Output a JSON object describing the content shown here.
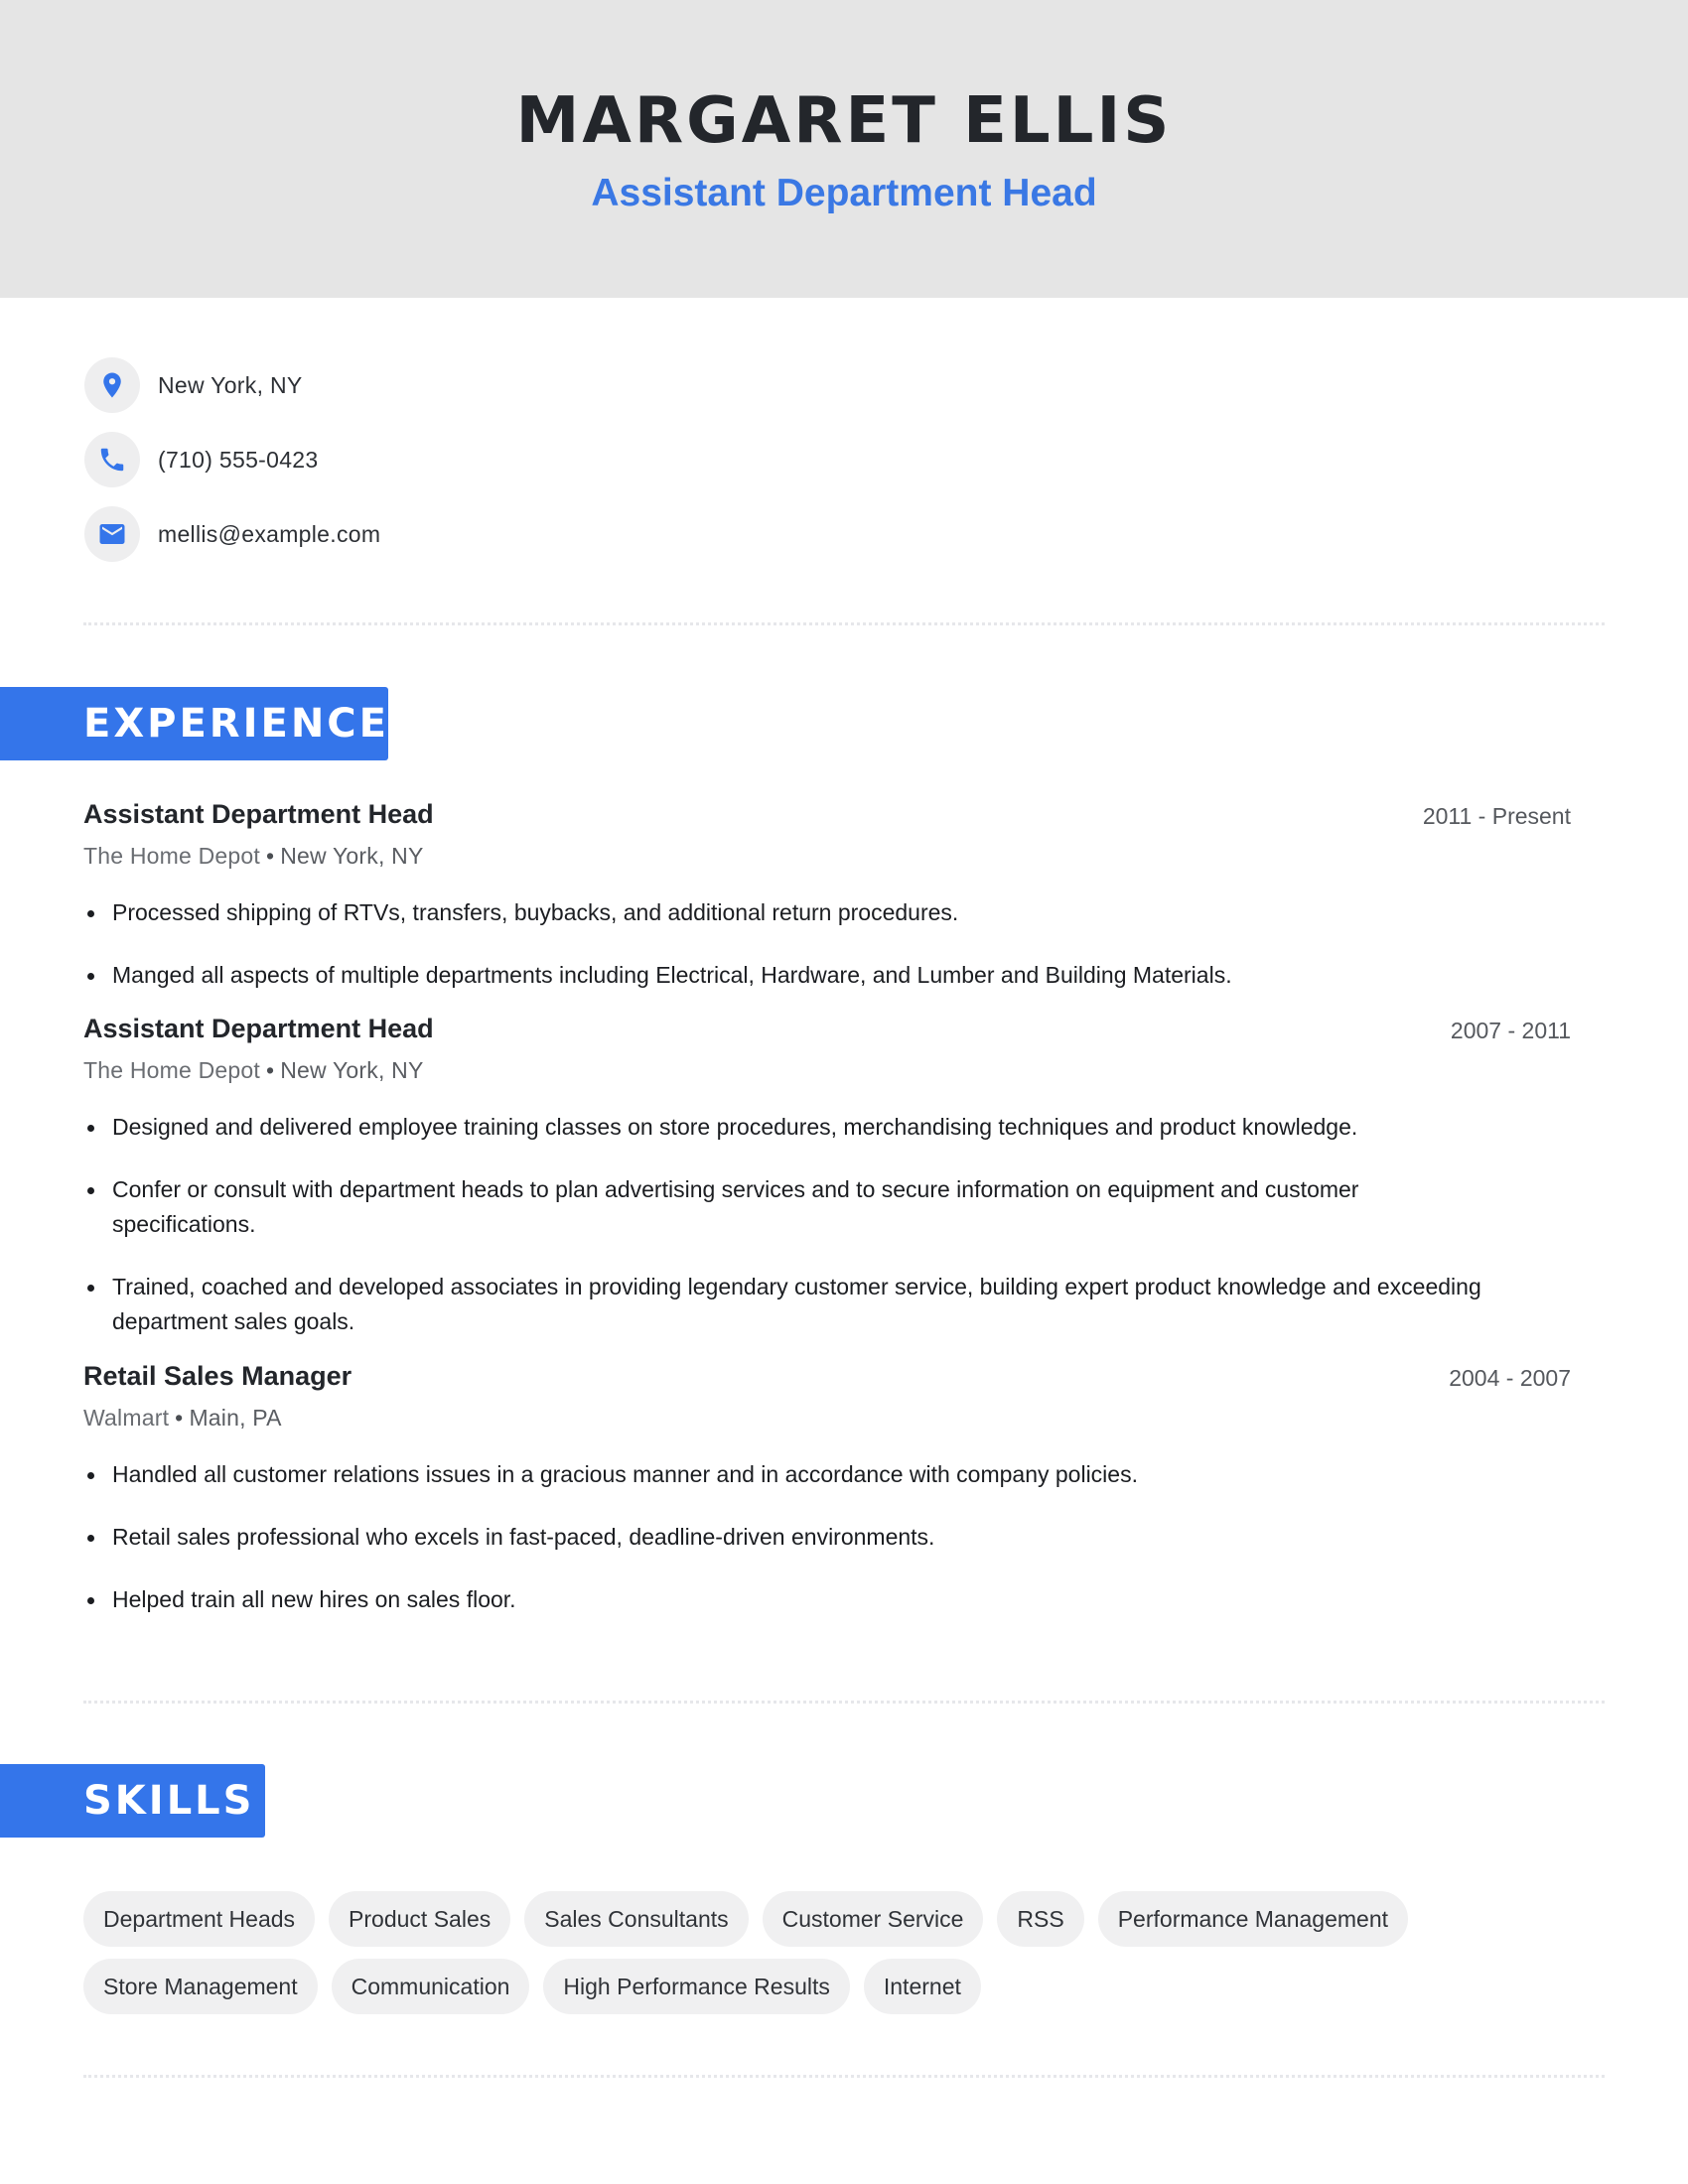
{
  "header": {
    "name": "MARGARET ELLIS",
    "headline": "Assistant Department Head"
  },
  "contact": {
    "items": [
      {
        "icon": "location-pin-icon",
        "value": "New York, NY"
      },
      {
        "icon": "phone-icon",
        "value": "(710) 555-0423"
      },
      {
        "icon": "email-icon",
        "value": "mellis@example.com"
      }
    ]
  },
  "sections": {
    "experience_title": "EXPERIENCE",
    "skills_title": "SKILLS"
  },
  "experience": [
    {
      "title": "Assistant Department Head",
      "dates": "2011 - Present",
      "company": "The Home Depot",
      "location": "New York, NY",
      "bullets": [
        "Processed shipping of RTVs, transfers, buybacks, and additional return procedures.",
        "Manged all aspects of multiple departments including Electrical, Hardware, and Lumber and Building Materials."
      ]
    },
    {
      "title": "Assistant Department Head",
      "dates": "2007 - 2011",
      "company": "The Home Depot",
      "location": "New York, NY",
      "bullets": [
        "Designed and delivered employee training classes on store procedures, merchandising techniques and product knowledge.",
        "Confer or consult with department heads to plan advertising services and to secure information on equipment and customer specifications.",
        "Trained, coached and developed associates in providing legendary customer service, building expert product knowledge and exceeding department sales goals."
      ]
    },
    {
      "title": "Retail Sales Manager",
      "dates": "2004 - 2007",
      "company": "Walmart",
      "location": "Main, PA",
      "bullets": [
        "Handled all customer relations issues in a gracious manner and in accordance with company policies.",
        "Retail sales professional who excels in fast-paced, deadline-driven environments.",
        "Helped train all new hires on sales floor."
      ]
    }
  ],
  "skills": {
    "row1": [
      "Department Heads",
      "Product Sales",
      "Sales Consultants",
      "Customer Service",
      "RSS",
      "Performance Management"
    ],
    "row2": [
      "Store Management",
      "Communication",
      "High Performance Results",
      "Internet"
    ]
  },
  "colors": {
    "accent": "#3475ea",
    "header_bg": "#e5e5e5",
    "chip_bg": "#f0f0f1"
  }
}
